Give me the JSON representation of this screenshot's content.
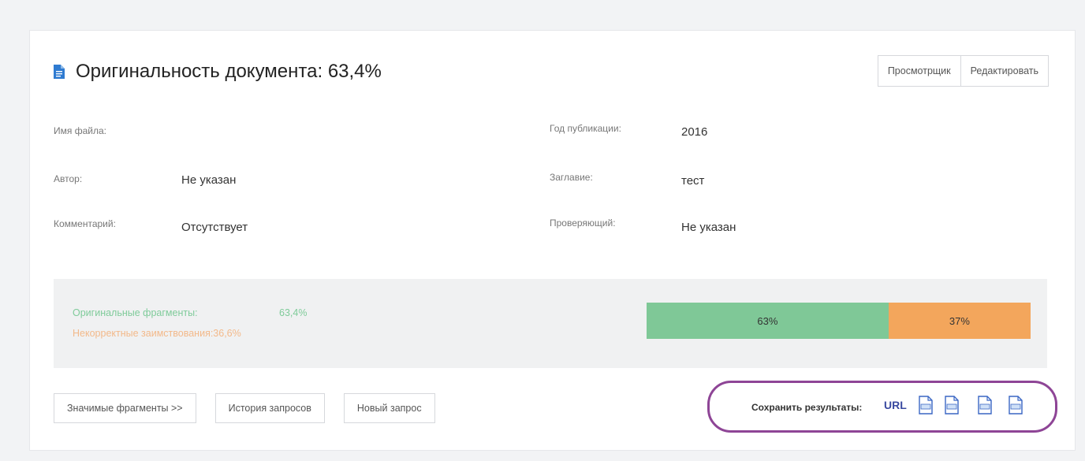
{
  "title": "Оригинальность документа: 63,4%",
  "top_buttons": {
    "viewer": "Просмотрщик",
    "edit": "Редактировать"
  },
  "info": {
    "file_name": {
      "label": "Имя файла:",
      "value": ""
    },
    "author": {
      "label": "Автор:",
      "value": "Не указан"
    },
    "comment": {
      "label": "Комментарий:",
      "value": "Отсутствует"
    },
    "pub_year": {
      "label": "Год публикации:",
      "value": "2016"
    },
    "heading": {
      "label": "Заглавие:",
      "value": "тест"
    },
    "reviewer": {
      "label": "Проверяющий:",
      "value": "Не указан"
    }
  },
  "stats": {
    "original": {
      "label": "Оригинальные фрагменты:",
      "value": "63,4%"
    },
    "incorrect": {
      "label": "Некорректные заимствования:36,6%"
    },
    "bar": [
      {
        "label": "63%",
        "fraction": 0.63,
        "color": "#7fc897"
      },
      {
        "label": "37%",
        "fraction": 0.37,
        "color": "#f3a65c"
      }
    ]
  },
  "bottom_buttons": {
    "fragments": "Значимые фрагменты >>",
    "history": "История запросов",
    "new_request": "Новый запрос"
  },
  "save": {
    "label": "Сохранить результаты:",
    "url": "URL",
    "icons": [
      "pdf-icon",
      "pdf-icon",
      "doc-icon",
      "docx-icon"
    ]
  },
  "colors": {
    "accent": "#2f7bd1",
    "original_text": "#7fcb9a",
    "incorrect_text": "#f3b98a",
    "highlight_circle": "#8e4596",
    "url_link": "#3a4aa0"
  }
}
